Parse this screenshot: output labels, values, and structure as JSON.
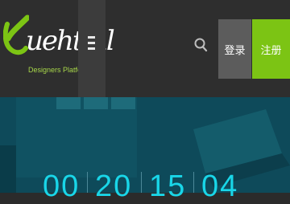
{
  "header": {
    "logo_text": "uehtml",
    "logo_subtitle": "Designers Platform",
    "menu_icon": "hamburger-icon",
    "search_icon": "search-icon",
    "login_label": "登录",
    "register_label": "注册"
  },
  "colors": {
    "header_bg": "#2e2e2e",
    "accent_green": "#7cc414",
    "login_bg": "#5c5c5c",
    "hero_bg": "#0e4a5a",
    "countdown_cyan": "#19d6e8"
  },
  "countdown": {
    "values": [
      "00",
      "20",
      "15",
      "04"
    ]
  }
}
